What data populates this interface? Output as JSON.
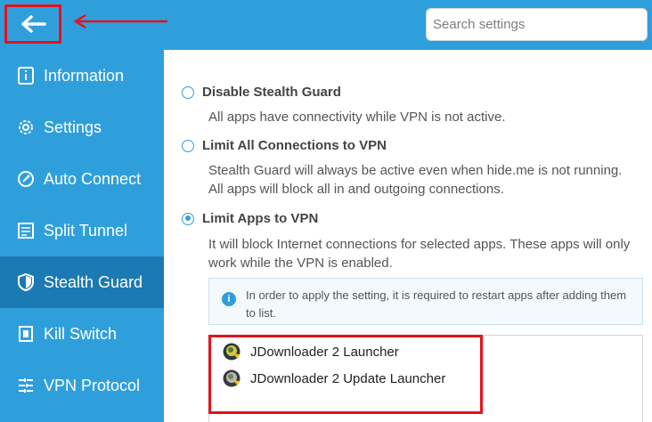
{
  "header": {
    "back_icon": "arrow-left-icon",
    "search_placeholder": "Search settings",
    "annotation_color": "#e4121b"
  },
  "sidebar": {
    "items": [
      {
        "label": "Information",
        "icon": "info-icon",
        "active": false
      },
      {
        "label": "Settings",
        "icon": "gear-icon",
        "active": false
      },
      {
        "label": "Auto Connect",
        "icon": "auto-connect-icon",
        "active": false
      },
      {
        "label": "Split Tunnel",
        "icon": "split-tunnel-icon",
        "active": false
      },
      {
        "label": "Stealth Guard",
        "icon": "shield-icon",
        "active": true
      },
      {
        "label": "Kill Switch",
        "icon": "kill-switch-icon",
        "active": false
      },
      {
        "label": "VPN Protocol",
        "icon": "protocol-icon",
        "active": false
      }
    ]
  },
  "stealth_guard": {
    "options": [
      {
        "label": "Disable Stealth Guard",
        "description": "All apps have connectivity while VPN is not active.",
        "selected": false
      },
      {
        "label": "Limit All Connections to VPN",
        "description": "Stealth Guard will always be active even when hide.me is not running. All apps will block all in and outgoing connections.",
        "selected": false
      },
      {
        "label": "Limit Apps to VPN",
        "description": "It will block Internet connections for selected apps. These apps will only work while the VPN is enabled.",
        "selected": true
      }
    ],
    "info_note": "In order to apply the setting, it is required to restart apps after adding them to list.",
    "apps": [
      {
        "name": "JDownloader 2 Launcher",
        "icon": "jdownloader-icon"
      },
      {
        "name": "JDownloader 2 Update Launcher",
        "icon": "jdownloader-update-icon"
      }
    ]
  },
  "colors": {
    "accent": "#2f9fdc",
    "active_nav": "#1b7ab4",
    "annotation": "#e4121b"
  }
}
